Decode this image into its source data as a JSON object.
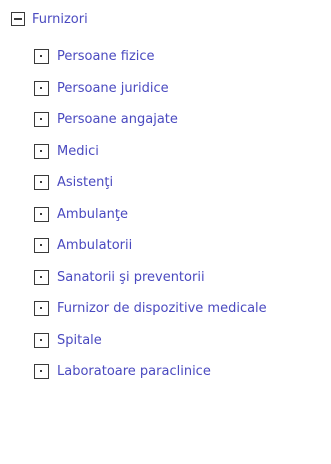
{
  "tree": {
    "root": {
      "label": "Furnizori",
      "expanded": true,
      "toggle_icon": "minus-box-icon"
    },
    "children": [
      {
        "label": "Persoane fizice"
      },
      {
        "label": "Persoane juridice"
      },
      {
        "label": "Persoane angajate"
      },
      {
        "label": "Medici"
      },
      {
        "label": "Asistenţi"
      },
      {
        "label": "Ambulanţe"
      },
      {
        "label": "Ambulatorii"
      },
      {
        "label": "Sanatorii şi preventorii"
      },
      {
        "label": "Furnizor de dispozitive medicale"
      },
      {
        "label": "Spitale"
      },
      {
        "label": "Laboratoare paraclinice"
      }
    ],
    "colors": {
      "link": "#4a4ac0",
      "icon_border": "#3a3a3a",
      "background": "#ffffff"
    }
  }
}
